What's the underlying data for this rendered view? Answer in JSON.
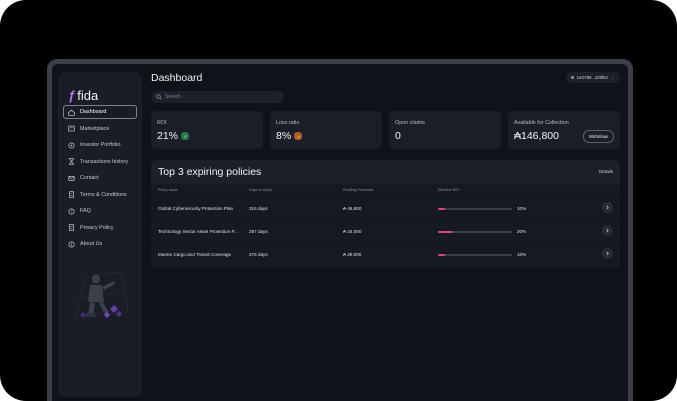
{
  "brand": {
    "name": "fida"
  },
  "sidebar": {
    "items": [
      {
        "label": "Dashboard",
        "icon": "home-icon",
        "active": true
      },
      {
        "label": "Marketplace",
        "icon": "store-icon",
        "active": false
      },
      {
        "label": "Investor Portfolio",
        "icon": "portfolio-icon",
        "active": false
      },
      {
        "label": "Transactions history",
        "icon": "hourglass-icon",
        "active": false
      },
      {
        "label": "Contact",
        "icon": "mail-icon",
        "active": false
      },
      {
        "label": "Terms & Conditions",
        "icon": "document-icon",
        "active": false
      },
      {
        "label": "FAQ",
        "icon": "question-icon",
        "active": false
      },
      {
        "label": "Privacy Policy",
        "icon": "document-icon",
        "active": false
      },
      {
        "label": "About Us",
        "icon": "info-icon",
        "active": false
      }
    ]
  },
  "header": {
    "title": "Dashboard",
    "search_placeholder": "Search",
    "wallet": "1eO788...329f62"
  },
  "cards": {
    "roi": {
      "label": "ROI",
      "value": "21%",
      "trend": "up"
    },
    "loss_ratio": {
      "label": "Loss ratio",
      "value": "8%",
      "trend": "down"
    },
    "open_claims": {
      "label": "Open claims",
      "value": "0"
    },
    "available": {
      "label": "Available for Collection",
      "value": "₳146,800",
      "button": "Withdraw"
    }
  },
  "policies": {
    "title": "Top 3 expiring policies",
    "details_label": "Details",
    "columns": [
      "Policy name",
      "Days to expiry",
      "Pending Premiums",
      "Effective ROI"
    ],
    "rows": [
      {
        "name": "Global Cybersecurity Protection Plan",
        "days": "316 days",
        "premium": "₳ 46,800",
        "roi": "10%",
        "roi_fraction": 0.1
      },
      {
        "name": "Technology Sector Asset Protection P...",
        "days": "287 days",
        "premium": "₳ 34,000",
        "roi": "20%",
        "roi_fraction": 0.2
      },
      {
        "name": "Marine Cargo and Transit Coverage",
        "days": "276 days",
        "premium": "₳ 29,000",
        "roi": "10%",
        "roi_fraction": 0.1
      }
    ]
  },
  "colors": {
    "accent": "#e2457e",
    "brand": "#c06cf5",
    "up": "#1f7a45",
    "down": "#b35a1e"
  }
}
